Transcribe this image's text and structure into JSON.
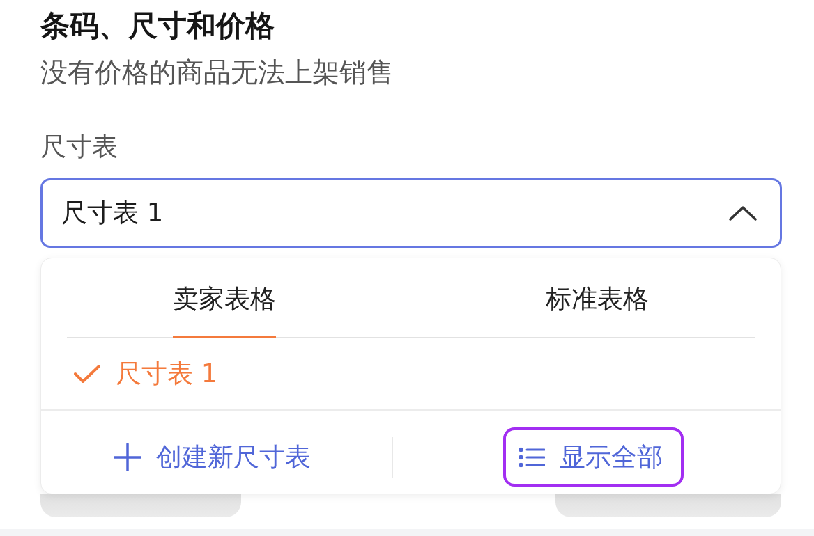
{
  "section": {
    "title": "条码、尺寸和价格",
    "subtitle": "没有价格的商品无法上架销售"
  },
  "size_chart_field": {
    "label": "尺寸表",
    "value": "尺寸表 1",
    "expanded": true
  },
  "dropdown": {
    "tabs": [
      {
        "label": "卖家表格",
        "selected": true
      },
      {
        "label": "标准表格",
        "selected": false
      }
    ],
    "options": [
      {
        "label": "尺寸表 1",
        "selected": true
      }
    ],
    "actions": [
      {
        "kind": "create",
        "label": "创建新尺寸表",
        "highlighted": false
      },
      {
        "kind": "show_all",
        "label": "显示全部",
        "highlighted": true
      }
    ]
  }
}
